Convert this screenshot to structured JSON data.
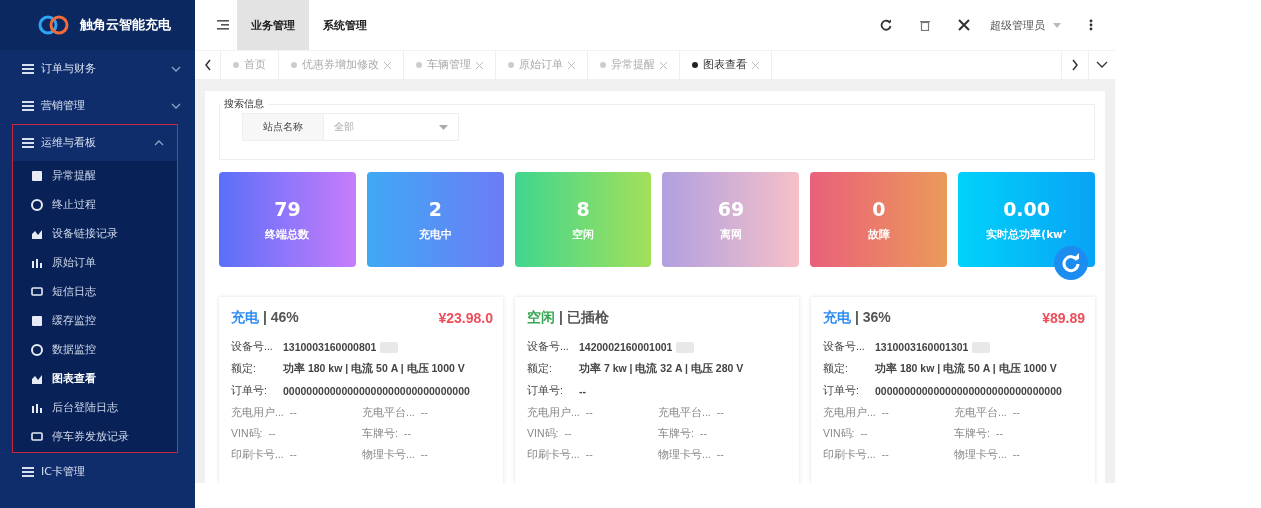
{
  "sidebar": {
    "logo": "触角云智能充电",
    "menu": [
      {
        "label": "订单与财务",
        "expandable": true,
        "expanded": false
      },
      {
        "label": "营销管理",
        "expandable": true,
        "expanded": false
      },
      {
        "label": "运维与看板",
        "expandable": true,
        "expanded": true,
        "highlighted": true,
        "children": [
          {
            "label": "异常提醒",
            "selected": false
          },
          {
            "label": "终止过程",
            "selected": false
          },
          {
            "label": "设备链接记录",
            "selected": false
          },
          {
            "label": "原始订单",
            "selected": false
          },
          {
            "label": "短信日志",
            "selected": false
          },
          {
            "label": "缓存监控",
            "selected": false
          },
          {
            "label": "数据监控",
            "selected": false
          },
          {
            "label": "图表查看",
            "selected": true
          },
          {
            "label": "后台登陆日志",
            "selected": false
          },
          {
            "label": "停车券发放记录",
            "selected": false
          }
        ]
      },
      {
        "label": "IC卡管理",
        "expandable": false,
        "expanded": false
      }
    ]
  },
  "header": {
    "modules": [
      {
        "label": "业务管理",
        "selected": true
      },
      {
        "label": "系统管理",
        "selected": false
      }
    ],
    "user": "超级管理员"
  },
  "tabs": [
    {
      "label": "首页",
      "selected": false,
      "closable": false
    },
    {
      "label": "优惠券增加修改",
      "selected": false,
      "closable": true
    },
    {
      "label": "车辆管理",
      "selected": false,
      "closable": true
    },
    {
      "label": "原始订单",
      "selected": false,
      "closable": true
    },
    {
      "label": "异常提醒",
      "selected": false,
      "closable": true
    },
    {
      "label": "图表查看",
      "selected": true,
      "closable": true
    }
  ],
  "search": {
    "legend": "搜索信息",
    "field_label": "站点名称",
    "value": "全部"
  },
  "stats": [
    {
      "value": "79",
      "label": "终端总数",
      "color": "#5b6ff9"
    },
    {
      "value": "2",
      "label": "充电中",
      "color": "#3fa9f5"
    },
    {
      "value": "8",
      "label": "空闲",
      "color": "#3fd68f"
    },
    {
      "value": "69",
      "label": "离网",
      "color": "#b0a0e0"
    },
    {
      "value": "0",
      "label": "故障",
      "color": "#e9607a"
    },
    {
      "value": "0.00",
      "label": "实时总功率(kw’",
      "color": "#00d2fa"
    }
  ],
  "devices": [
    {
      "status": "充电",
      "color": "#2d8cf0",
      "detail": "| 46%",
      "price": "¥23.98.0",
      "device_label": "设备号...",
      "device_no": "1310003160000801",
      "rated_label": "额定:",
      "rated": "功率 180 kw | 电流 50 A | 电压 1000 V",
      "order_label": "订单号:",
      "order_no": "00000000000000000000000000000000",
      "fields": [
        [
          "充电用户...",
          "--",
          "充电平台...",
          "--"
        ],
        [
          "VIN码:",
          "--",
          "车牌号:",
          "--"
        ],
        [
          "印刷卡号...",
          "--",
          "物理卡号...",
          "--"
        ]
      ]
    },
    {
      "status": "空闲",
      "color": "#3aa655",
      "detail": "| 已插枪",
      "device_label": "设备号...",
      "device_no": "1420002160001001",
      "rated_label": "额定:",
      "rated": "功率 7 kw | 电流 32 A | 电压 280 V",
      "order_label": "订单号:",
      "order_no": "--",
      "fields": [
        [
          "充电用户...",
          "--",
          "充电平台...",
          "--"
        ],
        [
          "VIN码:",
          "--",
          "车牌号:",
          "--"
        ],
        [
          "印刷卡号...",
          "--",
          "物理卡号...",
          "--"
        ]
      ]
    },
    {
      "status": "充电",
      "color": "#2d8cf0",
      "detail": "| 36%",
      "price": "¥89.89",
      "device_label": "设备号...",
      "device_no": "1310003160001301",
      "rated_label": "额定:",
      "rated": "功率 180 kw | 电流 50 A | 电压 1000 V",
      "order_label": "订单号:",
      "order_no": "00000000000000000000000000000000",
      "fields": [
        [
          "充电用户...",
          "--",
          "充电平台...",
          "--"
        ],
        [
          "VIN码:",
          "--",
          "车牌号:",
          "--"
        ],
        [
          "印刷卡号...",
          "--",
          "物理卡号...",
          "--"
        ]
      ]
    }
  ]
}
